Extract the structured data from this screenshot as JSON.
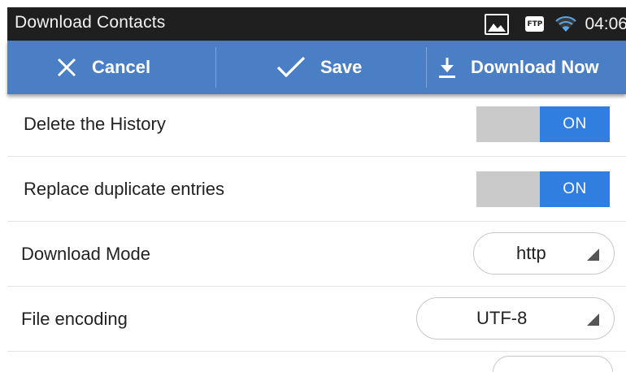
{
  "status_bar": {
    "title": "Download Contacts",
    "time": "04:06",
    "icons": [
      "image-icon",
      "ftp-icon",
      "wifi-icon"
    ],
    "ftp_label": "FTP"
  },
  "action_bar": {
    "cancel_label": "Cancel",
    "save_label": "Save",
    "download_label": "Download Now",
    "color": "#4a7fc6"
  },
  "settings": {
    "delete_history": {
      "label": "Delete the History",
      "state": "ON"
    },
    "replace_duplicates": {
      "label": "Replace duplicate entries",
      "state": "ON"
    },
    "download_mode": {
      "label": "Download Mode",
      "value": "http"
    },
    "file_encoding": {
      "label": "File encoding",
      "value": "UTF-8"
    }
  },
  "colors": {
    "toggle_on": "#2f7ee0",
    "toggle_off": "#cacaca",
    "status_bar_bg": "#1f1f1f"
  }
}
